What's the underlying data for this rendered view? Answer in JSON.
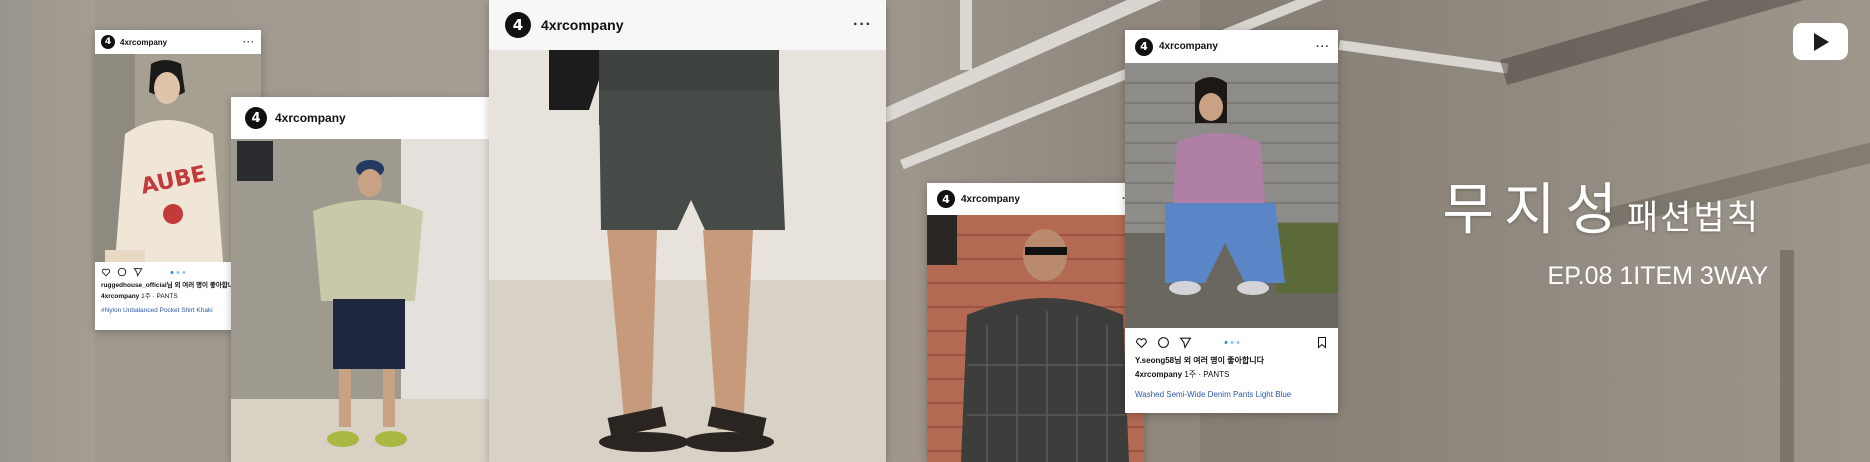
{
  "channel": {
    "username": "4xrcompany",
    "avatar_glyph": "4"
  },
  "posts": {
    "p1": {
      "liker_line": "ruggedhouse_official님 외 여러 명이 좋아합니다",
      "caption_user": "4xrcompany",
      "caption_text": "1주 · PANTS",
      "product_tag": "#Nylon Unbalanced Pocket Shirt Khaki"
    },
    "p5": {
      "liker_line": "Y.seong58님 외 여러 명이 좋아합니다",
      "caption_user": "4xrcompany",
      "caption_text": "1주 · PANTS",
      "product_tag": "Washed Semi-Wide Denim Pants Light Blue"
    }
  },
  "icons": {
    "menu": "more-dots-icon",
    "like": "heart-icon",
    "comment": "comment-icon",
    "share": "send-icon",
    "save": "bookmark-icon",
    "youtube": "youtube-play-icon"
  },
  "title": {
    "main": "무지성",
    "sub": "패션법칙",
    "episode": "EP.08 1ITEM 3WAY"
  },
  "colors": {
    "background": "#a49c92",
    "text_light": "#ffffff",
    "link_blue": "#2b5aa8",
    "pager_active": "#2f8fe0"
  }
}
